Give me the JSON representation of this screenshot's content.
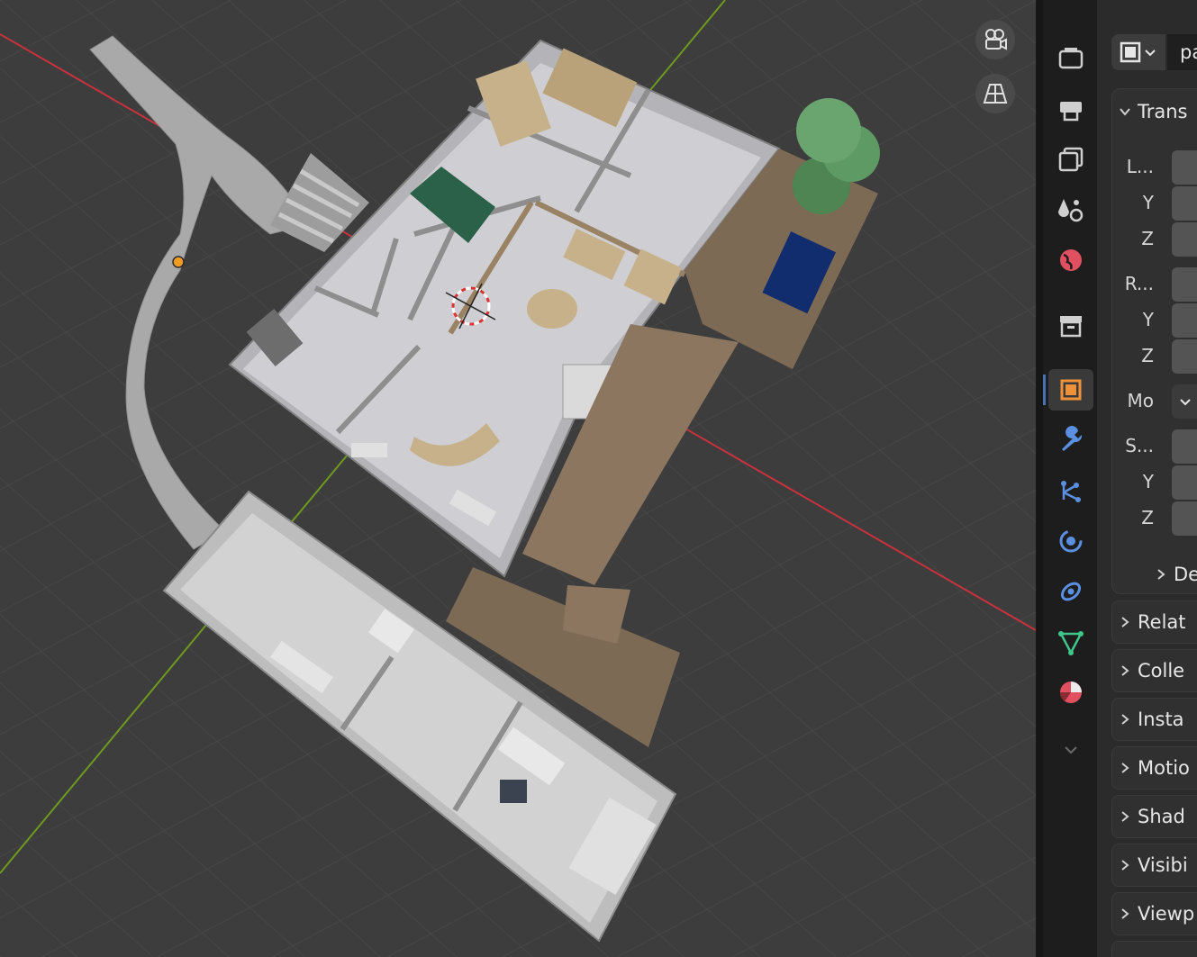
{
  "viewport": {
    "name": "3D Viewport",
    "nav_icons": [
      "camera-view-icon",
      "perspective-grid-icon"
    ]
  },
  "sidebar_tabs": [
    {
      "name": "render-properties-icon",
      "color": "#cfcfcf"
    },
    {
      "name": "output-properties-icon",
      "color": "#cfcfcf"
    },
    {
      "name": "view-layer-icon",
      "color": "#cfcfcf"
    },
    {
      "name": "scene-properties-icon",
      "color": "#cfcfcf"
    },
    {
      "name": "world-properties-icon",
      "color": "#e05060"
    },
    {
      "name": "collection-properties-icon",
      "color": "#cfcfcf"
    },
    {
      "name": "object-properties-icon",
      "color": "#f0913a",
      "active": true
    },
    {
      "name": "modifier-properties-icon",
      "color": "#5b8fe0"
    },
    {
      "name": "particle-properties-icon",
      "color": "#5b8fe0"
    },
    {
      "name": "physics-properties-icon",
      "color": "#5b8fe0"
    },
    {
      "name": "constraint-properties-icon",
      "color": "#5b8fe0"
    },
    {
      "name": "data-properties-icon",
      "color": "#3fc78b"
    },
    {
      "name": "material-properties-icon",
      "color": "#e05060"
    }
  ],
  "properties": {
    "object_name": "pa",
    "transform": {
      "title": "Trans",
      "rows": [
        {
          "label": "L...",
          "top": 0
        },
        {
          "label": "Y"
        },
        {
          "label": "Z"
        },
        {
          "label": "R..."
        },
        {
          "label": "Y"
        },
        {
          "label": "Z"
        },
        {
          "label": "Mo"
        },
        {
          "label": "S..."
        },
        {
          "label": "Y"
        },
        {
          "label": "Z"
        }
      ],
      "delta_label": "De"
    },
    "sections": [
      "Relat",
      "Colle",
      "Insta",
      "Motio",
      "Shad",
      "Visibi",
      "Viewp"
    ]
  }
}
